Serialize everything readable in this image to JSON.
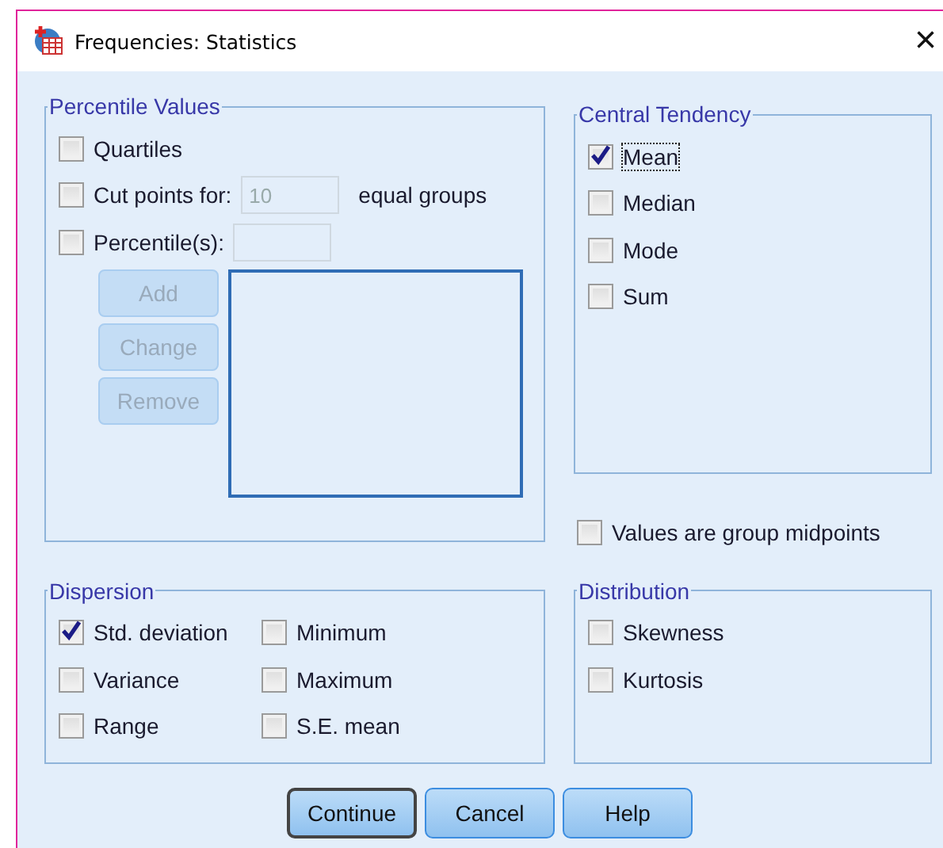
{
  "window": {
    "title": "Frequencies: Statistics",
    "close": "×"
  },
  "percentile_values": {
    "legend": "Percentile Values",
    "quartiles": {
      "label": "Quartiles",
      "checked": false
    },
    "cut_points": {
      "label": "Cut points for:",
      "checked": false,
      "value": "10",
      "disabled": true,
      "suffix": "equal groups"
    },
    "percentiles": {
      "label": "Percentile(s):",
      "checked": false,
      "disabled": true
    },
    "buttons": [
      {
        "label": "Add",
        "disabled": true
      },
      {
        "label": "Change",
        "disabled": true
      },
      {
        "label": "Remove",
        "disabled": true
      }
    ]
  },
  "central_tendency": {
    "legend": "Central Tendency",
    "items": [
      {
        "label": "Mean",
        "checked": true,
        "focused": true
      },
      {
        "label": "Median",
        "checked": false,
        "focused": false
      },
      {
        "label": "Mode",
        "checked": false,
        "focused": false
      },
      {
        "label": "Sum",
        "checked": false,
        "focused": false
      }
    ]
  },
  "group_midpoints": {
    "label": "Values are group midpoints",
    "checked": false
  },
  "dispersion": {
    "legend": "Dispersion",
    "items": [
      {
        "label": "Std. deviation",
        "checked": true
      },
      {
        "label": "Minimum",
        "checked": false
      },
      {
        "label": "Variance",
        "checked": false
      },
      {
        "label": "Maximum",
        "checked": false
      },
      {
        "label": "Range",
        "checked": false
      },
      {
        "label": "S.E. mean",
        "checked": false
      }
    ]
  },
  "distribution": {
    "legend": "Distribution",
    "items": [
      {
        "label": "Skewness",
        "checked": false
      },
      {
        "label": "Kurtosis",
        "checked": false
      }
    ]
  },
  "buttons": [
    {
      "label": "Continue",
      "default": true
    },
    {
      "label": "Cancel",
      "default": false
    },
    {
      "label": "Help",
      "default": false
    }
  ]
}
